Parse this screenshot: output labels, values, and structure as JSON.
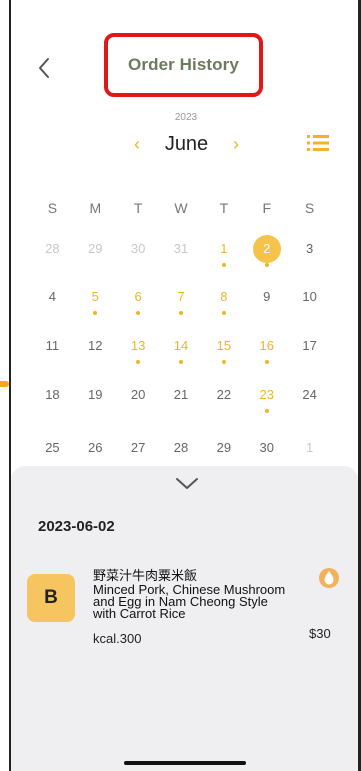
{
  "header": {
    "back_icon": "chevron-left-icon",
    "title": "Order History"
  },
  "calendar": {
    "year": "2023",
    "month": "June",
    "prev_icon": "chevron-left-icon",
    "next_icon": "chevron-right-icon",
    "view_toggle_icon": "list-icon",
    "weekdays": [
      "S",
      "M",
      "T",
      "W",
      "T",
      "F",
      "S"
    ],
    "weeks": [
      [
        {
          "d": "28",
          "s": "other"
        },
        {
          "d": "29",
          "s": "other"
        },
        {
          "d": "30",
          "s": "other"
        },
        {
          "d": "31",
          "s": "other"
        },
        {
          "d": "1",
          "s": "highlight",
          "dot": true
        },
        {
          "d": "2",
          "s": "selected",
          "dot": true
        },
        {
          "d": "3",
          "s": "normal"
        }
      ],
      [
        {
          "d": "4",
          "s": "normal"
        },
        {
          "d": "5",
          "s": "highlight",
          "dot": true
        },
        {
          "d": "6",
          "s": "highlight",
          "dot": true
        },
        {
          "d": "7",
          "s": "highlight",
          "dot": true
        },
        {
          "d": "8",
          "s": "highlight",
          "dot": true
        },
        {
          "d": "9",
          "s": "normal"
        },
        {
          "d": "10",
          "s": "normal"
        }
      ],
      [
        {
          "d": "11",
          "s": "normal"
        },
        {
          "d": "12",
          "s": "normal"
        },
        {
          "d": "13",
          "s": "highlight",
          "dot": true
        },
        {
          "d": "14",
          "s": "highlight",
          "dot": true
        },
        {
          "d": "15",
          "s": "highlight",
          "dot": true
        },
        {
          "d": "16",
          "s": "highlight",
          "dot": true
        },
        {
          "d": "17",
          "s": "normal"
        }
      ],
      [
        {
          "d": "18",
          "s": "normal"
        },
        {
          "d": "19",
          "s": "normal"
        },
        {
          "d": "20",
          "s": "normal"
        },
        {
          "d": "21",
          "s": "normal"
        },
        {
          "d": "22",
          "s": "normal"
        },
        {
          "d": "23",
          "s": "highlight",
          "dot": true
        },
        {
          "d": "24",
          "s": "normal"
        }
      ],
      [
        {
          "d": "25",
          "s": "normal"
        },
        {
          "d": "26",
          "s": "normal"
        },
        {
          "d": "27",
          "s": "normal"
        },
        {
          "d": "28",
          "s": "normal"
        },
        {
          "d": "29",
          "s": "normal"
        },
        {
          "d": "30",
          "s": "normal"
        },
        {
          "d": "1",
          "s": "other"
        }
      ]
    ]
  },
  "details": {
    "collapse_icon": "chevron-down-icon",
    "date": "2023-06-02",
    "order": {
      "badge": "B",
      "name_zh": "野菜汁牛肉粟米飯",
      "name_en": "Minced Pork, Chinese Mushroom and Egg in Nam Cheong Style with Carrot Rice",
      "diet_icon": "drop-icon",
      "kcal": "kcal.300",
      "price": "$30"
    }
  },
  "colors": {
    "accent": "#f0b429",
    "selected": "#f5c24a",
    "title": "#6b7c5d",
    "highlight_box": "#e01818",
    "sheet_bg": "#efeff1"
  }
}
